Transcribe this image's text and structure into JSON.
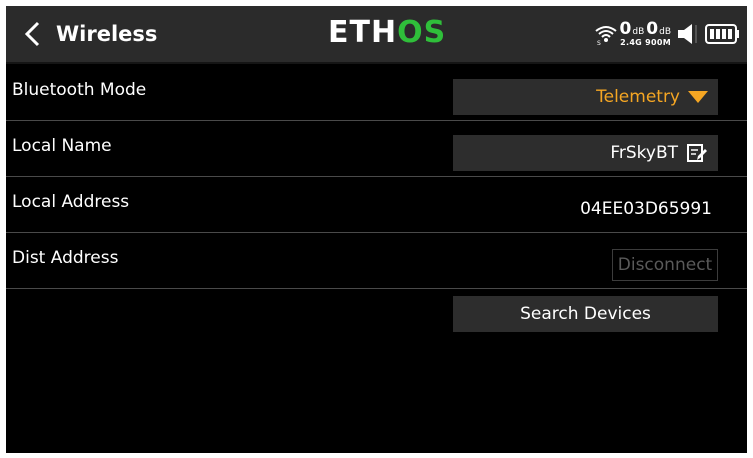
{
  "header": {
    "title": "Wireless",
    "logo_part1": "ETH",
    "logo_part2": "OS",
    "rssi_24": "0",
    "rssi_900": "0",
    "db_unit": "dB",
    "freq_labels": "2.4G 900M"
  },
  "rows": [
    {
      "label": "Bluetooth Mode",
      "value": "Telemetry"
    },
    {
      "label": "Local Name",
      "value": "FrSkyBT"
    },
    {
      "label": "Local Address",
      "value": "04EE03D65991"
    },
    {
      "label": "Dist Address",
      "value": "Disconnect"
    }
  ],
  "search_button": "Search Devices",
  "colors": {
    "background": "#000000",
    "header": "#2b2b2b",
    "field": "#2d2d2d",
    "accent_orange": "#f5a623",
    "logo_green": "#2fbf3a",
    "disabled_text": "#5a5a5a"
  },
  "icons": [
    "back-chevron-icon",
    "wifi-signal-icon",
    "speaker-icon",
    "battery-icon",
    "edit-icon",
    "dropdown-triangle-icon"
  ]
}
